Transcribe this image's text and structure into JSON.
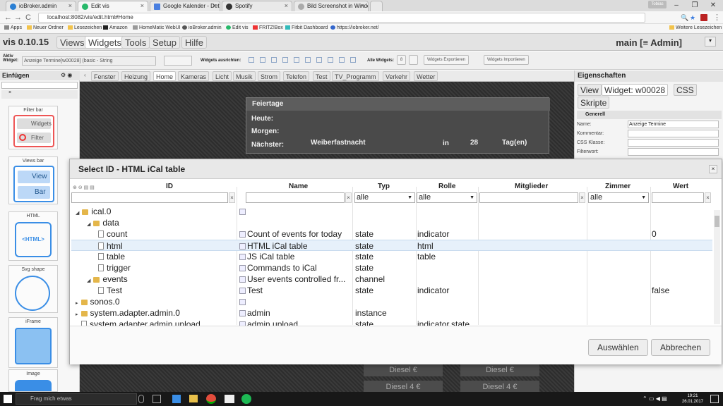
{
  "browser": {
    "tabs": [
      "ioBroker.admin",
      "Edit vis",
      "Google Kalender - Detai",
      "Spotify",
      "Bild Screenshot in Windo"
    ],
    "user_badge": "Tobias",
    "url": "localhost:8082/vis/edit.html#Home",
    "bookmarks": [
      "Apps",
      "Neuer Ordner",
      "Lesezeichen",
      "Amazon",
      "HomeMatic WebUI",
      "ioBroker.admin",
      "Edit vis",
      "FRITZ!Box",
      "Fitbit Dashboard",
      "https://iobroker.net/",
      "Weitere Lesezeichen"
    ]
  },
  "vis": {
    "title": "vis 0.10.15",
    "menu": [
      "Views",
      "Widgets",
      "Tools",
      "Setup",
      "Hilfe"
    ],
    "main_view": "main [≡ Admin]",
    "toolbar": {
      "aktiv_label": "Aktiv Widget:",
      "aktiv_value": "Anzeige Termine[w00028] (basic - String",
      "ausrichten": "Widgets ausrichten:",
      "alle": "Alle Widgets:",
      "alle_value": "8",
      "export": "Widgets Exportieren",
      "import": "Widgets Importieren"
    },
    "left": {
      "header": "Einfügen",
      "widgets": [
        "Filter bar",
        "Views bar",
        "HTML",
        "Svg shape",
        "iFrame",
        "Image"
      ],
      "filter_buttons": [
        "Widgets",
        "Filter"
      ],
      "view_buttons": [
        "View",
        "Bar"
      ]
    },
    "view_tabs": [
      "Fenster",
      "Heizung",
      "Home",
      "Kameras",
      "Licht",
      "Musik",
      "Strom",
      "Telefon",
      "Test",
      "TV_Programm",
      "Verkehr",
      "Wetter"
    ],
    "canvas": {
      "widget_title": "Feiertage",
      "rows": [
        "Heute:",
        "Morgen:",
        "Nächster:"
      ],
      "next_name": "Weiberfastnacht",
      "next_in": "in",
      "next_days": "28",
      "next_unit": "Tag(en)",
      "diesel": [
        "Diesel",
        "Diesel",
        "Diesel",
        "Diesel"
      ],
      "diesel_prices": [
        "€",
        "€",
        "4 €",
        "4 €"
      ]
    },
    "right": {
      "header": "Eigenschaften",
      "tabs": [
        "View",
        "Widget: w00028",
        "CSS",
        "Skripte"
      ],
      "section": "Generell",
      "props": [
        {
          "k": "Name:",
          "v": "Anzeige Termine"
        },
        {
          "k": "Kommentar:",
          "v": ""
        },
        {
          "k": "CSS Klasse:",
          "v": ""
        },
        {
          "k": "Filterwort:",
          "v": ""
        }
      ]
    }
  },
  "dialog": {
    "title": "Select ID - HTML iCal table",
    "columns": [
      "ID",
      "Name",
      "Typ",
      "Rolle",
      "Mitglieder",
      "Zimmer",
      "Wert"
    ],
    "filters": {
      "typ": "alle",
      "rolle": "alle",
      "zimmer": "alle"
    },
    "rows": [
      {
        "id": "ical.0",
        "name": "",
        "typ": "",
        "rolle": "",
        "wert": "",
        "kind": "folder",
        "tog": "◢"
      },
      {
        "id": "data",
        "name": "",
        "typ": "",
        "rolle": "",
        "wert": "",
        "kind": "folder",
        "tog": "◢"
      },
      {
        "id": "count",
        "name": "Count of events for today",
        "typ": "state",
        "rolle": "indicator",
        "wert": "0",
        "kind": "file",
        "tog": ""
      },
      {
        "id": "html",
        "name": "HTML iCal table",
        "typ": "state",
        "rolle": "html",
        "wert": "",
        "kind": "file",
        "tog": ""
      },
      {
        "id": "table",
        "name": "JS iCal table",
        "typ": "state",
        "rolle": "table",
        "wert": "",
        "kind": "file",
        "tog": ""
      },
      {
        "id": "trigger",
        "name": "Commands to iCal",
        "typ": "state",
        "rolle": "",
        "wert": "",
        "kind": "file",
        "tog": ""
      },
      {
        "id": "events",
        "name": "User events controlled fr...",
        "typ": "channel",
        "rolle": "",
        "wert": "",
        "kind": "folder",
        "tog": "◢"
      },
      {
        "id": "Test",
        "name": "Test",
        "typ": "state",
        "rolle": "indicator",
        "wert": "false",
        "kind": "file",
        "tog": ""
      },
      {
        "id": "sonos.0",
        "name": "",
        "typ": "",
        "rolle": "",
        "wert": "",
        "kind": "folder",
        "tog": "▸"
      },
      {
        "id": "system.adapter.admin.0",
        "name": "admin",
        "typ": "instance",
        "rolle": "",
        "wert": "",
        "kind": "folder",
        "tog": "▸"
      },
      {
        "id": "system.adapter.admin.upload",
        "name": "admin.upload",
        "typ": "state",
        "rolle": "indicator.state",
        "wert": "",
        "kind": "file",
        "tog": ""
      }
    ],
    "buttons": {
      "select": "Auswählen",
      "cancel": "Abbrechen"
    }
  },
  "taskbar": {
    "search": "Frag mich etwas",
    "time": "19:21",
    "date": "26.01.2017"
  }
}
